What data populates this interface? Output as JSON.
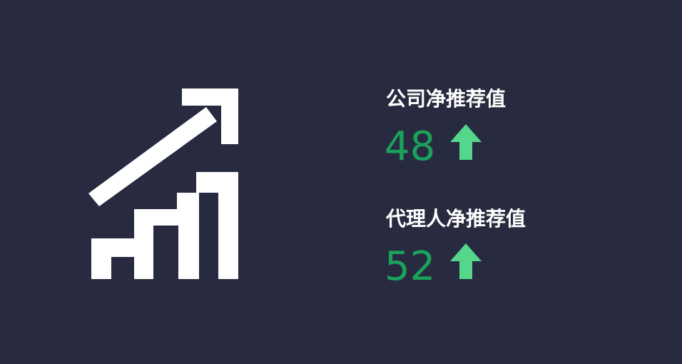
{
  "colors": {
    "background": "#282b3f",
    "graphic": "#ffffff",
    "value": "#1aa15b",
    "arrow": "#55d68a",
    "label": "#ffffff"
  },
  "graphic": {
    "icon": "growth-chart-icon"
  },
  "metrics": [
    {
      "label": "公司净推荐值",
      "value": "48",
      "trend_icon": "arrow-up-icon"
    },
    {
      "label": "代理人净推荐值",
      "value": "52",
      "trend_icon": "arrow-up-icon"
    }
  ]
}
